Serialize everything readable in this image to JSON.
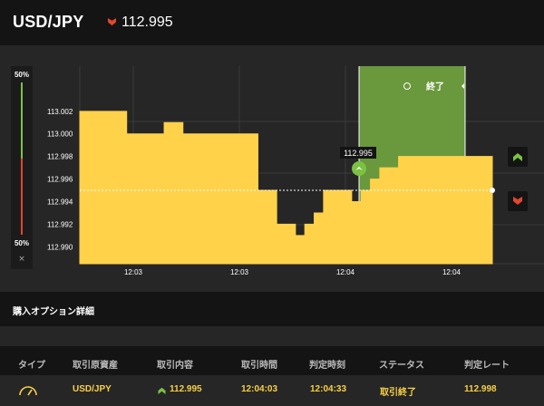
{
  "header": {
    "pair": "USD/JPY",
    "rate": "112.995",
    "rate_direction_icon": "down-arrow-icon",
    "down_color": "#e0472e"
  },
  "gauge": {
    "top_label": "50%",
    "bottom_label": "50%",
    "close_label": "×",
    "up_color": "#7cc242",
    "down_color": "#e0472e"
  },
  "chart": {
    "type": "area",
    "current_rate_label": "112.995",
    "expiry_label": "終了",
    "area_color": "#ffd24a",
    "zone_color": "#6a983c",
    "y_ticks": [
      "113.002",
      "113.000",
      "112.998",
      "112.996",
      "112.994",
      "112.992",
      "112.990"
    ],
    "x_ticks": [
      "12:03",
      "12:03",
      "12:04",
      "12:04"
    ]
  },
  "chart_data": {
    "type": "area",
    "ylim": [
      112.9885,
      113.006
    ],
    "x_ticks": [
      "12:03",
      "12:03",
      "12:04",
      "12:04"
    ],
    "y_ticks": [
      113.002,
      113.0,
      112.998,
      112.996,
      112.994,
      112.992,
      112.99
    ],
    "series": [
      {
        "values": [
          113.002,
          113.002,
          113.002,
          113.002,
          113.002,
          113.0,
          113.0,
          113.0,
          113.0,
          113.001,
          113.001,
          113.0,
          113.0,
          113.0,
          113.0,
          113.0,
          113.0,
          113.0,
          113.0,
          112.995,
          112.995,
          112.992,
          112.992,
          112.991,
          112.992,
          112.993,
          112.995,
          112.995,
          112.995,
          112.994,
          112.995,
          112.996,
          112.997,
          112.997,
          112.998,
          112.998,
          112.998,
          112.998,
          112.998,
          112.998,
          112.998,
          112.998,
          112.998,
          112.998,
          112.995
        ]
      }
    ],
    "current_rate": 112.995,
    "purchase_marker": "12:04"
  },
  "buttons": {
    "high_icon": "up-arrow-icon",
    "low_icon": "down-arrow-icon"
  },
  "details": {
    "title": "購入オプション詳細",
    "columns": [
      "タイプ",
      "取引原資産",
      "取引内容",
      "取引時間",
      "判定時刻",
      "ステータス",
      "判定レート"
    ],
    "row": {
      "type_icon": "gauge-icon",
      "asset": "USD/JPY",
      "direction_icon": "up-arrow-icon",
      "content": "112.995",
      "trade_time": "12:04:03",
      "judge_time": "12:04:33",
      "status": "取引終了",
      "judge_rate": "112.998"
    }
  }
}
